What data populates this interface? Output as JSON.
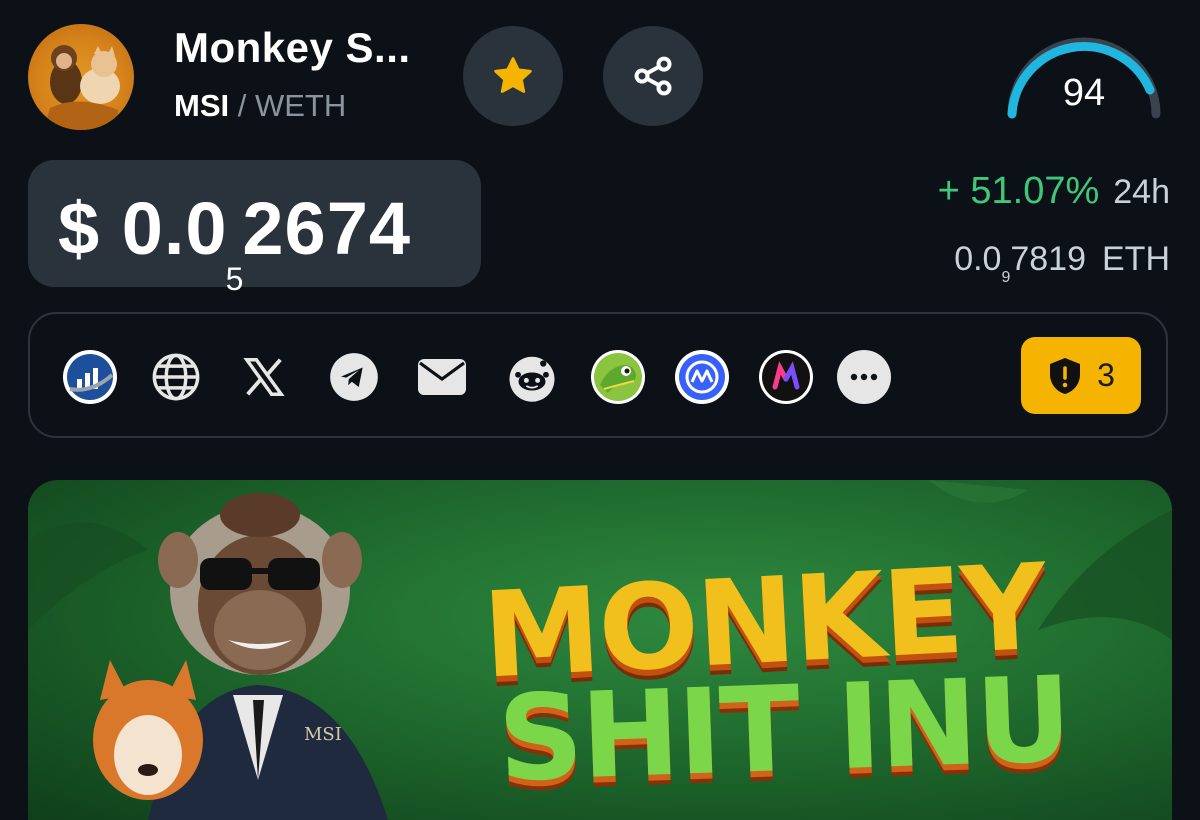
{
  "header": {
    "token_name": "Monkey S...",
    "pair_base": "MSI",
    "pair_sep": " / ",
    "pair_quote": "WETH",
    "score": "94"
  },
  "price": {
    "prefix": "$ 0.0",
    "zeros": "5",
    "digits": "2674"
  },
  "change": {
    "percent": "+ 51.07%",
    "period": "24h"
  },
  "eth_price": {
    "prefix": "0.0",
    "zeros": "9",
    "digits": "7819",
    "unit": "ETH"
  },
  "links": {
    "icons": [
      "chart-logo-icon",
      "globe-icon",
      "x-icon",
      "telegram-icon",
      "email-icon",
      "reddit-icon",
      "coingecko-icon",
      "coinmarketcap-icon",
      "multi-m-icon",
      "more-icon"
    ],
    "alerts_count": "3"
  },
  "banner": {
    "title_line1": "MONKEY",
    "title_line2": "SHIT INU",
    "badge": "MSI"
  },
  "colors": {
    "background": "#0c1117",
    "panel": "#2a323b",
    "accent_yellow": "#f4b400",
    "positive": "#3ec97a",
    "gauge": "#1fb6e0"
  }
}
